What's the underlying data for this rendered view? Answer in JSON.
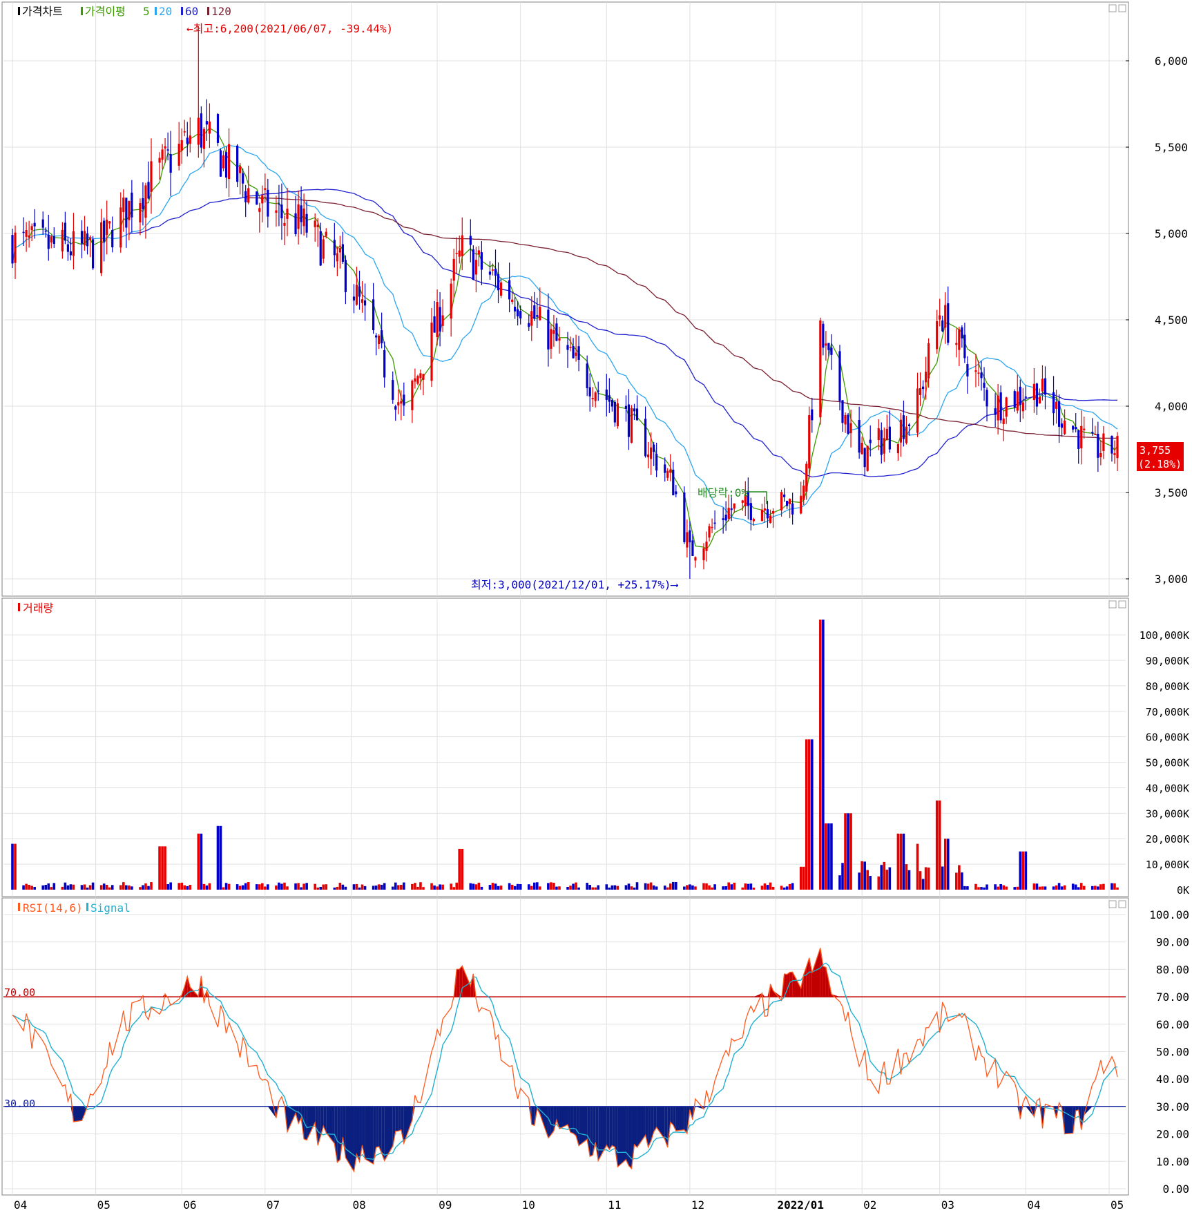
{
  "colors": {
    "up": "#e60000",
    "down": "#0000c8",
    "ma5": "#3c9b00",
    "ma20": "#2aa5f0",
    "ma60": "#2020d0",
    "ma120": "#7a1f30",
    "rsi": "#ff5a1e",
    "signal": "#20b0d0",
    "grid": "#e0e0e0",
    "frame": "#808080"
  },
  "price_panel": {
    "legend": {
      "price": "가격차트",
      "ma_title": "가격이평",
      "ma5": "5",
      "ma20": "20",
      "ma60": "60",
      "ma120": "120"
    },
    "y_ticks": [
      "6,000",
      "5,500",
      "5,000",
      "4,500",
      "4,000",
      "3,500",
      "3,000"
    ],
    "high_annotation": "←최고:6,200(2021/06/07, -39.44%)",
    "low_annotation": "최저:3,000(2021/12/01, +25.17%)⟶",
    "ex_rights_label": "배당락:0%",
    "last_price": "3,755",
    "last_change": "(2.18%)"
  },
  "volume_panel": {
    "legend": "거래량",
    "y_ticks": [
      "100,000K",
      "90,000K",
      "80,000K",
      "70,000K",
      "60,000K",
      "50,000K",
      "40,000K",
      "30,000K",
      "20,000K",
      "10,000K",
      "0K"
    ]
  },
  "rsi_panel": {
    "legend_rsi": "RSI(14,6)",
    "legend_signal": "Signal",
    "y_ticks": [
      "100.00",
      "90.00",
      "80.00",
      "70.00",
      "60.00",
      "50.00",
      "40.00",
      "30.00",
      "20.00",
      "10.00",
      "0.00"
    ],
    "upper_label": "70.00",
    "lower_label": "30.00"
  },
  "x_axis": {
    "labels": [
      "04",
      "05",
      "06",
      "07",
      "08",
      "09",
      "10",
      "11",
      "12",
      "2022/01",
      "02",
      "03",
      "04",
      "05"
    ]
  },
  "chart_data": [
    {
      "type": "candlestick",
      "title": "가격차트",
      "ylim": [
        3000,
        6200
      ],
      "grid": true,
      "x_period": "2021/04 – 2022/05 (daily)",
      "anchor_points": [
        {
          "date": "2021-04",
          "close": 4950
        },
        {
          "date": "2021-05-01",
          "close": 4900
        },
        {
          "date": "2021-05-20",
          "close": 5300
        },
        {
          "date": "2021-06-07",
          "high": 6200,
          "close": 5600
        },
        {
          "date": "2021-06-30",
          "close": 5150
        },
        {
          "date": "2021-07-15",
          "close": 5050
        },
        {
          "date": "2021-07-31",
          "close": 4750
        },
        {
          "date": "2021-08-20",
          "close": 3950
        },
        {
          "date": "2021-09-10",
          "close": 4900
        },
        {
          "date": "2021-10-01",
          "close": 4600
        },
        {
          "date": "2021-10-20",
          "close": 4250
        },
        {
          "date": "2021-11-10",
          "close": 3900
        },
        {
          "date": "2021-11-25",
          "close": 3550
        },
        {
          "date": "2021-12-01",
          "low": 3000,
          "close": 3150
        },
        {
          "date": "2021-12-15",
          "close": 3400
        },
        {
          "date": "2022-01-10",
          "close": 3450
        },
        {
          "date": "2022-01-17",
          "close": 4400
        },
        {
          "date": "2022-01-31",
          "close": 3700
        },
        {
          "date": "2022-02-20",
          "close": 3950
        },
        {
          "date": "2022-03-01",
          "close": 4550
        },
        {
          "date": "2022-03-20",
          "close": 4000
        },
        {
          "date": "2022-04-05",
          "close": 4100
        },
        {
          "date": "2022-04-25",
          "close": 3750
        },
        {
          "date": "2022-05-04",
          "close": 3755
        }
      ],
      "moving_averages": [
        "5",
        "20",
        "60",
        "120"
      ]
    },
    {
      "type": "bar",
      "title": "거래량",
      "unit": "K",
      "ylim": [
        0,
        100000
      ],
      "peaks": [
        {
          "date": "2021-04",
          "value": 18000
        },
        {
          "date": "2021-05-25",
          "value": 17000
        },
        {
          "date": "2021-06-07",
          "value": 22000
        },
        {
          "date": "2021-06-14",
          "value": 25000
        },
        {
          "date": "2021-09-10",
          "value": 16000
        },
        {
          "date": "2022-01-10",
          "value": 9000
        },
        {
          "date": "2022-01-13",
          "value": 59000
        },
        {
          "date": "2022-01-17",
          "value": 106000
        },
        {
          "date": "2022-01-20",
          "value": 26000
        },
        {
          "date": "2022-01-27",
          "value": 30000
        },
        {
          "date": "2022-02-15",
          "value": 22000
        },
        {
          "date": "2022-02-20",
          "value": 18000
        },
        {
          "date": "2022-02-28",
          "value": 35000
        },
        {
          "date": "2022-03-04",
          "value": 20000
        },
        {
          "date": "2022-03-31",
          "value": 15000
        }
      ]
    },
    {
      "type": "line",
      "title": "RSI(14,6)",
      "series": [
        {
          "name": "RSI(14,6)"
        },
        {
          "name": "Signal"
        }
      ],
      "ylim": [
        0,
        100
      ],
      "reference_lines": [
        70,
        30
      ],
      "rsi_anchor_points": [
        {
          "date": "2021-04",
          "value": 68
        },
        {
          "date": "2021-04-25",
          "value": 25
        },
        {
          "date": "2021-05-10",
          "value": 60
        },
        {
          "date": "2021-06-07",
          "value": 76
        },
        {
          "date": "2021-07-10",
          "value": 23
        },
        {
          "date": "2021-08-01",
          "value": 12
        },
        {
          "date": "2021-08-20",
          "value": 18
        },
        {
          "date": "2021-09-10",
          "value": 82
        },
        {
          "date": "2021-10-05",
          "value": 25
        },
        {
          "date": "2021-11-08",
          "value": 10
        },
        {
          "date": "2021-12-01",
          "value": 25
        },
        {
          "date": "2021-12-25",
          "value": 65
        },
        {
          "date": "2022-01-17",
          "value": 83
        },
        {
          "date": "2022-02-05",
          "value": 38
        },
        {
          "date": "2022-03-05",
          "value": 65
        },
        {
          "date": "2022-03-30",
          "value": 30
        },
        {
          "date": "2022-04-20",
          "value": 24
        },
        {
          "date": "2022-05-01",
          "value": 51
        },
        {
          "date": "2022-05-04",
          "value": 45
        }
      ]
    }
  ]
}
